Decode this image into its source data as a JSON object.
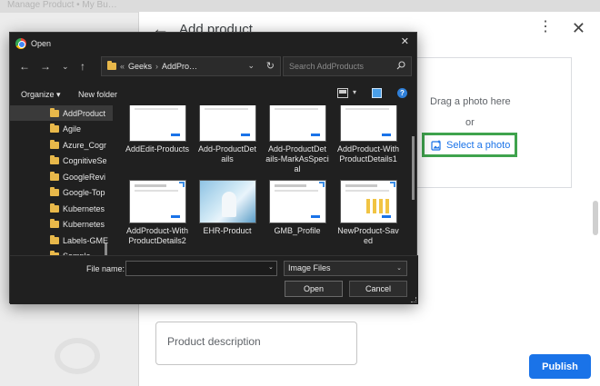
{
  "background": {
    "top_text": "Manage Product • My Bu…"
  },
  "panel": {
    "title": "Add product",
    "drag_text": "Drag a photo here",
    "or_text": "or",
    "select_photo": "Select a photo",
    "description_label": "Product description",
    "publish": "Publish",
    "icons": [
      "back-arrow-icon",
      "more-vert-icon",
      "close-icon",
      "add-photo-icon"
    ],
    "accent": "#1a73e8",
    "highlight": "#3fa34d"
  },
  "dialog": {
    "title": "Open",
    "path": {
      "prefix": "«",
      "parent": "Geeks",
      "sep": "›",
      "current": "AddPro…"
    },
    "search_placeholder": "Search AddProducts",
    "toolbar": {
      "organize": "Organize ▾",
      "new_folder": "New folder"
    },
    "tree": [
      {
        "label": "AddProduct",
        "selected": true
      },
      {
        "label": "Agile"
      },
      {
        "label": "Azure_Cogr"
      },
      {
        "label": "CognitiveSe"
      },
      {
        "label": "GoogleRevi"
      },
      {
        "label": "Google-Top"
      },
      {
        "label": "Kubernetes"
      },
      {
        "label": "Kubernetes"
      },
      {
        "label": "Labels-GME"
      },
      {
        "label": "Sample"
      }
    ],
    "files": [
      {
        "name": "AddEdit-Products",
        "kind": "screenshot"
      },
      {
        "name": "Add-ProductDetails",
        "kind": "screenshot"
      },
      {
        "name": "Add-ProductDetails-MarkAsSpecial",
        "kind": "screenshot"
      },
      {
        "name": "AddProduct-WithProductDetails1",
        "kind": "screenshot"
      },
      {
        "name": "AddProduct-WithProductDetails2",
        "kind": "screenshot"
      },
      {
        "name": "EHR-Product",
        "kind": "photo"
      },
      {
        "name": "GMB_Profile",
        "kind": "screenshot"
      },
      {
        "name": "NewProduct-Saved",
        "kind": "chart"
      }
    ],
    "file_labels": [
      [
        "AddEdit-Products"
      ],
      [
        "Add-ProductDet",
        "ails"
      ],
      [
        "Add-ProductDet",
        "ails-MarkAsSpeci",
        "al"
      ],
      [
        "AddProduct-With",
        "ProductDetails1"
      ],
      [
        "AddProduct-With",
        "ProductDetails2"
      ],
      [
        "EHR-Product"
      ],
      [
        "GMB_Profile"
      ],
      [
        "NewProduct-Sav",
        "ed"
      ]
    ],
    "filename_label": "File name:",
    "filename_value": "",
    "filetype": "Image Files",
    "open_button": "Open",
    "cancel_button": "Cancel"
  }
}
